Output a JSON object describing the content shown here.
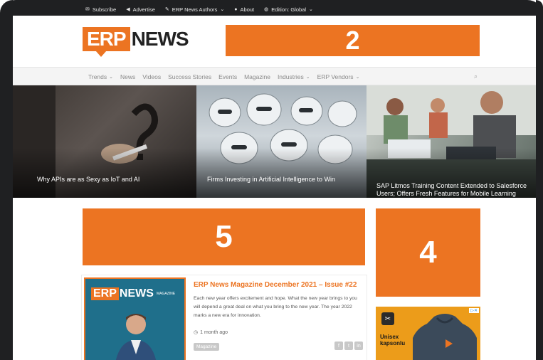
{
  "topbar": {
    "items": [
      {
        "icon": "envelope-icon",
        "label": "Subscribe"
      },
      {
        "icon": "megaphone-icon",
        "label": "Advertise"
      },
      {
        "icon": "pencil-icon",
        "label": "ERP News Authors",
        "dropdown": true
      },
      {
        "icon": "info-icon",
        "label": "About"
      },
      {
        "icon": "globe-icon",
        "label": "Edition: Global",
        "dropdown": true
      }
    ]
  },
  "header": {
    "logo_erp": "ERP",
    "logo_news": "NEWS",
    "banner_label": "2"
  },
  "nav": {
    "items": [
      {
        "label": "Trends",
        "dropdown": true
      },
      {
        "label": "News",
        "dropdown": false
      },
      {
        "label": "Videos",
        "dropdown": false
      },
      {
        "label": "Success Stories",
        "dropdown": false
      },
      {
        "label": "Events",
        "dropdown": false
      },
      {
        "label": "Magazine",
        "dropdown": false
      },
      {
        "label": "Industries",
        "dropdown": true
      },
      {
        "label": "ERP Vendors",
        "dropdown": true
      }
    ]
  },
  "hero": {
    "cards": [
      {
        "title": "Why APIs are as Sexy as IoT and AI"
      },
      {
        "title": "Firms Investing in Artificial Intelligence to Win"
      },
      {
        "title": "SAP Litmos Training Content Extended to Salesforce Users; Offers Fresh Features for Mobile Learning"
      }
    ]
  },
  "content": {
    "banner_main_label": "5",
    "banner_side_label": "4"
  },
  "article": {
    "cover_logo_erp": "ERP",
    "cover_logo_news": "NEWS",
    "cover_tag": "MAGAZINE",
    "title": "ERP News Magazine December 2021 – Issue #22",
    "body": "Each new year offers excitement and hope. What the new year brings to you will depend a great deal on what you bring to the new year. The year 2022 marks a new era for innovation.",
    "time": "1 month ago",
    "category": "Magazine",
    "share": [
      "f",
      "t",
      "in"
    ]
  },
  "ad": {
    "badge": "▷✕",
    "text_line1": "Unisex",
    "text_line2": "kapsonlu"
  },
  "colors": {
    "accent": "#ec7422",
    "nav_text": "#8a8a8a",
    "bezel": "#1f2022"
  }
}
